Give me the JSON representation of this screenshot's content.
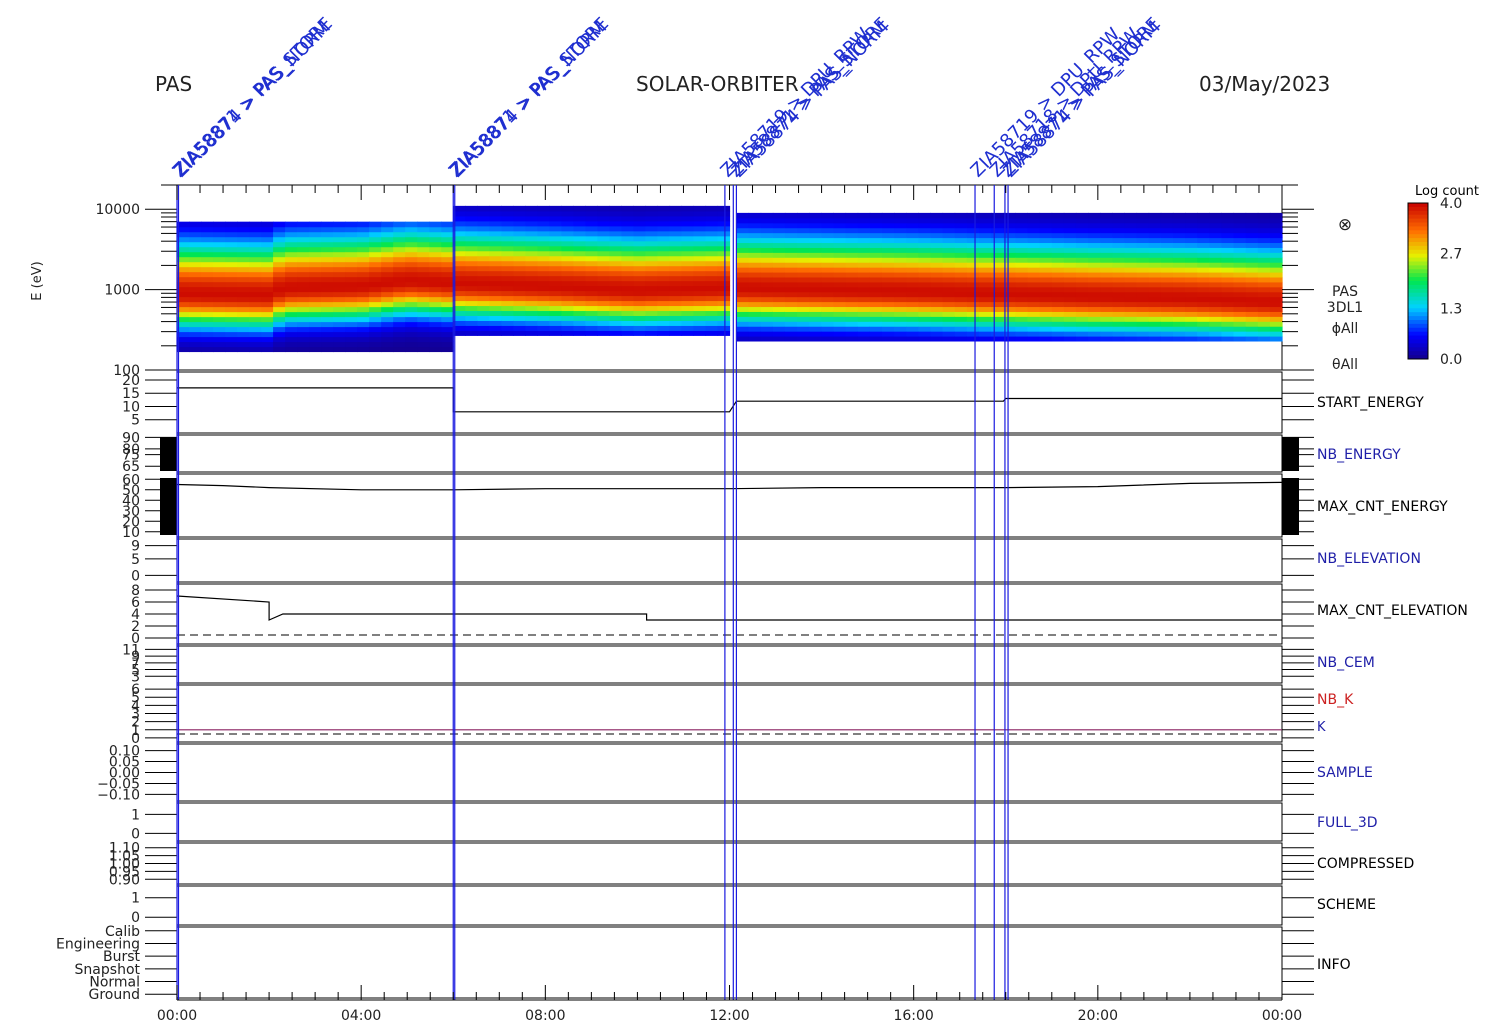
{
  "header": {
    "instrument": "PAS",
    "mission": "SOLAR-ORBITER",
    "date": "03/May/2023"
  },
  "events": [
    {
      "label": "ZIA58871 > PAS_STORE",
      "time": 0.0
    },
    {
      "label": "ZIA58874 > PAS_NORM",
      "time": 0.0
    },
    {
      "label": "ZIA58871 > PAS_STORE",
      "time": 6.0
    },
    {
      "label": "ZIA58874 > PAS_NORM",
      "time": 6.0
    },
    {
      "label": "ZIA58719 > DPU_RPW",
      "time": 11.9
    },
    {
      "label": "ZIA58871 > PAS_STORE",
      "time": 12.05
    },
    {
      "label": "ZIA58874 > PAS_NORM",
      "time": 12.15
    },
    {
      "label": "ZIA58719 > DPU_RPW",
      "time": 17.3
    },
    {
      "label": "ZIA58718 > DPU_RPW",
      "time": 17.75
    },
    {
      "label": "ZIA58871 > PAS_STORE",
      "time": 17.95
    },
    {
      "label": "ZIA58874 > PAS_NORM",
      "time": 18.05
    }
  ],
  "colorbar": {
    "title": "Log count",
    "ticks": [
      "4.0",
      "2.7",
      "1.3",
      "0.0"
    ],
    "range": [
      0.0,
      4.0
    ]
  },
  "spectrogram": {
    "ylabel": "E (eV)",
    "yticks": [
      "10000",
      "1000",
      "100"
    ],
    "ylim": [
      100,
      20000
    ],
    "side_labels": [
      "PAS",
      "3DL1",
      "ϕAll",
      "θAll"
    ],
    "symbol": "⊗",
    "peak_energy": [
      {
        "t": 0.0,
        "e": 900
      },
      {
        "t": 1.0,
        "e": 880
      },
      {
        "t": 2.0,
        "e": 860
      },
      {
        "t": 2.3,
        "e": 1050
      },
      {
        "t": 4.0,
        "e": 1100
      },
      {
        "t": 5.0,
        "e": 1300
      },
      {
        "t": 6.0,
        "e": 1200
      },
      {
        "t": 8.0,
        "e": 1100
      },
      {
        "t": 10.0,
        "e": 980
      },
      {
        "t": 10.5,
        "e": 1000
      },
      {
        "t": 12.0,
        "e": 1050
      },
      {
        "t": 14.0,
        "e": 1000
      },
      {
        "t": 16.0,
        "e": 950
      },
      {
        "t": 18.0,
        "e": 880
      },
      {
        "t": 20.0,
        "e": 820
      },
      {
        "t": 22.0,
        "e": 780
      },
      {
        "t": 24.0,
        "e": 700
      }
    ],
    "coverage": [
      {
        "t0": 0.0,
        "t1": 6.0,
        "emin": 170,
        "emax": 7000
      },
      {
        "t0": 6.0,
        "t1": 12.0,
        "emin": 270,
        "emax": 11000
      },
      {
        "t0": 12.15,
        "t1": 24.0,
        "emin": 230,
        "emax": 9000
      }
    ]
  },
  "panels": [
    {
      "id": "start_energy",
      "label": "START_ENERGY",
      "label_color": "#000000",
      "yticks": [
        "20",
        "15",
        "10",
        "5"
      ],
      "tick_values": [
        20,
        15,
        10,
        5
      ],
      "ylim": [
        0,
        23
      ],
      "line": [
        {
          "t": 0.0,
          "v": 17
        },
        {
          "t": 6.0,
          "v": 17
        },
        {
          "t": 6.0,
          "v": 8
        },
        {
          "t": 12.0,
          "v": 8
        },
        {
          "t": 12.15,
          "v": 12
        },
        {
          "t": 17.95,
          "v": 12
        },
        {
          "t": 18.0,
          "v": 13
        },
        {
          "t": 24.0,
          "v": 13
        }
      ]
    },
    {
      "id": "nb_energy",
      "label": "NB_ENERGY",
      "label_color": "#1f1fa8",
      "yticks": [
        "90",
        "80",
        "75",
        "65"
      ],
      "tick_values": [
        90,
        80,
        75,
        65
      ],
      "ylim": [
        60,
        92
      ],
      "line": []
    },
    {
      "id": "max_cnt_energy",
      "label": "MAX_CNT_ENERGY",
      "label_color": "#000000",
      "yticks": [
        "60",
        "50",
        "40",
        "30",
        "20",
        "10"
      ],
      "tick_values": [
        60,
        50,
        40,
        30,
        20,
        10
      ],
      "ylim": [
        5,
        65
      ],
      "line": [
        {
          "t": 0.0,
          "v": 55
        },
        {
          "t": 1.0,
          "v": 54
        },
        {
          "t": 2.0,
          "v": 52
        },
        {
          "t": 4.0,
          "v": 50
        },
        {
          "t": 6.0,
          "v": 50
        },
        {
          "t": 8.0,
          "v": 51
        },
        {
          "t": 10.0,
          "v": 51
        },
        {
          "t": 12.0,
          "v": 51
        },
        {
          "t": 14.0,
          "v": 52
        },
        {
          "t": 16.0,
          "v": 52
        },
        {
          "t": 18.0,
          "v": 52
        },
        {
          "t": 20.0,
          "v": 53
        },
        {
          "t": 22.0,
          "v": 56
        },
        {
          "t": 24.0,
          "v": 57
        }
      ]
    },
    {
      "id": "nb_elevation",
      "label": "NB_ELEVATION",
      "label_color": "#1f1fa8",
      "yticks": [
        "9",
        "5",
        "0"
      ],
      "tick_values": [
        9,
        5,
        0
      ],
      "ylim": [
        -2,
        11
      ],
      "line": []
    },
    {
      "id": "max_cnt_elevation",
      "label": "MAX_CNT_ELEVATION",
      "label_color": "#000000",
      "yticks": [
        "8",
        "6",
        "4",
        "2",
        "0"
      ],
      "tick_values": [
        8,
        6,
        4,
        2,
        0
      ],
      "ylim": [
        -1,
        9
      ],
      "line": [
        {
          "t": 0.0,
          "v": 7
        },
        {
          "t": 2.0,
          "v": 6
        },
        {
          "t": 2.0,
          "v": 3
        },
        {
          "t": 2.3,
          "v": 4
        },
        {
          "t": 10.2,
          "v": 4
        },
        {
          "t": 10.2,
          "v": 3
        },
        {
          "t": 24.0,
          "v": 3
        }
      ]
    },
    {
      "id": "nb_cem",
      "label": "NB_CEM",
      "label_color": "#1f1fa8",
      "yticks": [
        "11",
        "9",
        "7",
        "5",
        "3"
      ],
      "tick_values": [
        11,
        9,
        7,
        5,
        3
      ],
      "ylim": [
        1,
        12
      ],
      "line": []
    },
    {
      "id": "nb_k",
      "label": "NB_K",
      "label_color": "#cc2222",
      "yticks": [
        "6",
        "5",
        "4",
        "3",
        "2",
        "1",
        "0"
      ],
      "tick_values": [
        6,
        5,
        4,
        3,
        2,
        1,
        0
      ],
      "ylim": [
        -0.5,
        6.5
      ],
      "line": [
        {
          "t": 0.0,
          "v": 1
        },
        {
          "t": 24.0,
          "v": 1
        }
      ]
    },
    {
      "id": "sample",
      "label": "SAMPLE",
      "label_color": "#1f1fa8",
      "yticks": [
        "0.10",
        "0.05",
        "0.00",
        "−0.05",
        "−0.10"
      ],
      "tick_values": [
        0.1,
        0.05,
        0.0,
        -0.05,
        -0.1
      ],
      "ylim": [
        -0.13,
        0.13
      ],
      "line": []
    },
    {
      "id": "full_3d",
      "label": "FULL_3D",
      "label_color": "#1f1fa8",
      "yticks": [
        "1",
        "0"
      ],
      "tick_values": [
        1,
        0
      ],
      "ylim": [
        -0.4,
        1.6
      ],
      "line": []
    },
    {
      "id": "compressed",
      "label": "COMPRESSED",
      "label_color": "#000000",
      "yticks": [
        "1.10",
        "1.05",
        "1.00",
        "0.95",
        "0.90"
      ],
      "tick_values": [
        1.1,
        1.05,
        1.0,
        0.95,
        0.9
      ],
      "ylim": [
        0.87,
        1.13
      ],
      "line": []
    },
    {
      "id": "scheme",
      "label": "SCHEME",
      "label_color": "#000000",
      "yticks": [
        "1",
        "0"
      ],
      "tick_values": [
        1,
        0
      ],
      "ylim": [
        -0.4,
        1.6
      ],
      "line": []
    },
    {
      "id": "info",
      "label": "INFO",
      "label_color": "#000000",
      "yticks": [
        "Calib",
        "Engineering",
        "Burst",
        "Snapshot",
        "Normal",
        "Ground"
      ],
      "tick_values": [
        5,
        4,
        3,
        2,
        1,
        0
      ],
      "ylim": [
        -0.3,
        5.3
      ],
      "line": []
    }
  ],
  "k_label": "K",
  "xaxis": {
    "ticks": [
      "00:00",
      "04:00",
      "08:00",
      "12:00",
      "16:00",
      "20:00",
      "00:00"
    ],
    "tick_hours": [
      0,
      4,
      8,
      12,
      16,
      20,
      24
    ],
    "range": [
      0,
      24
    ]
  },
  "chart_data": {
    "type": "heatmap",
    "title": "SOLAR-ORBITER",
    "xlabel": "",
    "ylabel": "E (eV)",
    "x_ticks": [
      "00:00",
      "04:00",
      "08:00",
      "12:00",
      "16:00",
      "20:00",
      "00:00"
    ],
    "y_ticks": [
      "10000",
      "1000",
      "100"
    ],
    "ylim": [
      100,
      20000
    ],
    "yscale": "log",
    "colorbar": {
      "title": "Log count",
      "ticks": [
        "4.0",
        "2.7",
        "1.3",
        "0.0"
      ],
      "range": [
        0.0,
        4.0
      ]
    },
    "series": [
      {
        "name": "START_ENERGY",
        "values": [
          17,
          8,
          12,
          13
        ]
      },
      {
        "name": "MAX_CNT_ENERGY",
        "values": [
          55,
          50,
          51,
          52,
          57
        ]
      },
      {
        "name": "MAX_CNT_ELEVATION",
        "values": [
          7,
          4,
          3,
          3
        ]
      }
    ]
  }
}
